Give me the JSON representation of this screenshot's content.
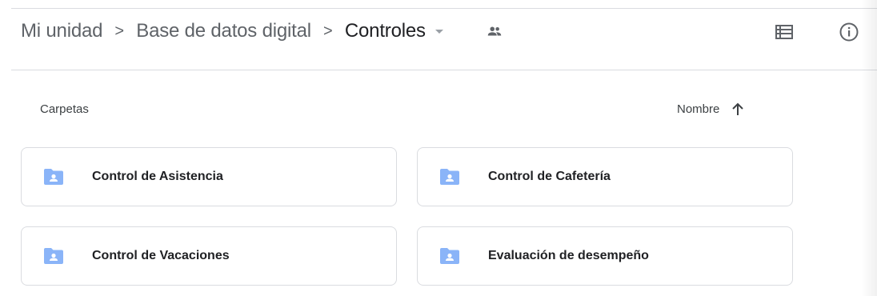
{
  "breadcrumb": {
    "items": [
      {
        "label": "Mi unidad"
      },
      {
        "label": "Base de datos digital"
      },
      {
        "label": "Controles"
      }
    ],
    "separator": ">",
    "dropdown_icon": "arrow-drop-down-icon",
    "shared_icon": "people-icon"
  },
  "toolbar": {
    "list_view_icon": "list-view-icon",
    "info_icon": "info-icon"
  },
  "section": {
    "label": "Carpetas",
    "sort_label": "Nombre",
    "sort_icon": "arrow-up-icon"
  },
  "folders": [
    {
      "name": "Control de Asistencia",
      "icon": "shared-folder-icon"
    },
    {
      "name": "Control de Cafetería",
      "icon": "shared-folder-icon"
    },
    {
      "name": "Control de Vacaciones",
      "icon": "shared-folder-icon"
    },
    {
      "name": "Evaluación de desempeño",
      "icon": "shared-folder-icon"
    }
  ],
  "colors": {
    "folder_icon": "#8ab4f8",
    "text_primary": "#202124",
    "text_secondary": "#5f6368",
    "border": "#dadce0"
  }
}
